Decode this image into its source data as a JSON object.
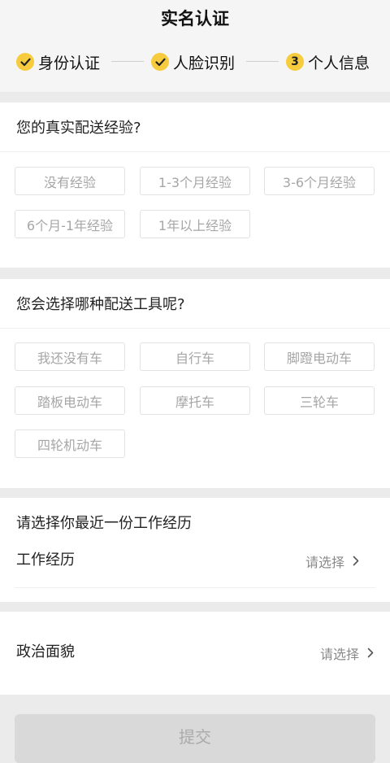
{
  "header": {
    "title": "实名认证",
    "steps": [
      {
        "label": "身份认证",
        "state": "done",
        "icon": "check-icon"
      },
      {
        "label": "人脸识别",
        "state": "done",
        "icon": "check-icon"
      },
      {
        "label": "个人信息",
        "state": "current",
        "number": "3"
      }
    ]
  },
  "experience": {
    "question": "您的真实配送经验?",
    "options": [
      "没有经验",
      "1-3个月经验",
      "3-6个月经验",
      "6个月-1年经验",
      "1年以上经验"
    ]
  },
  "vehicle": {
    "question": "您会选择哪种配送工具呢?",
    "options": [
      "我还没有车",
      "自行车",
      "脚蹬电动车",
      "踏板电动车",
      "摩托车",
      "三轮车",
      "四轮机动车"
    ]
  },
  "work_history": {
    "heading": "请选择你最近一份工作经历",
    "label": "工作经历",
    "value": "请选择"
  },
  "political_status": {
    "label": "政治面貌",
    "value": "请选择"
  },
  "submit": {
    "label": "提交"
  },
  "colors": {
    "accent": "#f6cc3e",
    "background": "#ebebeb",
    "option_text": "#a6a6a6",
    "submit_disabled": "#d9d9d9"
  }
}
